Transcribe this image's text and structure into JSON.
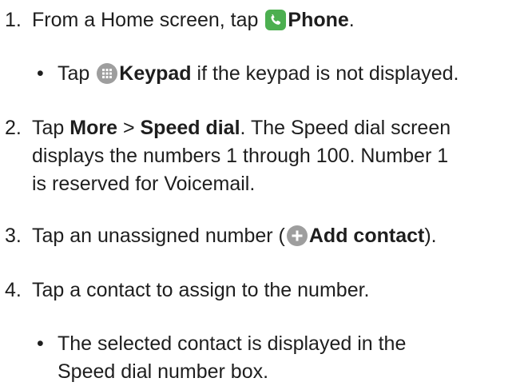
{
  "steps": [
    {
      "number": "1.",
      "pre": "From a Home screen, tap ",
      "bold": "Phone",
      "post": ".",
      "sub": {
        "bullet": "•",
        "pre": "Tap ",
        "bold": "Keypad",
        "post": " if the keypad is not displayed."
      }
    },
    {
      "number": "2.",
      "line1_pre": "Tap ",
      "line1_bold1": "More",
      "line1_sep": " > ",
      "line1_bold2": "Speed dial",
      "line1_post": ". The Speed dial screen",
      "line2": "displays the numbers 1 through 100. Number 1",
      "line3": "is reserved for Voicemail."
    },
    {
      "number": "3.",
      "pre": "Tap an unassigned number (",
      "bold": "Add contact",
      "post": ")."
    },
    {
      "number": "4.",
      "text": "Tap a contact to assign to the number.",
      "sub": {
        "bullet": "•",
        "line1": "The selected contact is displayed in the",
        "line2": "Speed dial number box."
      }
    }
  ],
  "colors": {
    "phone_icon": "#4caf50",
    "gray_icon": "#9e9e9e"
  }
}
